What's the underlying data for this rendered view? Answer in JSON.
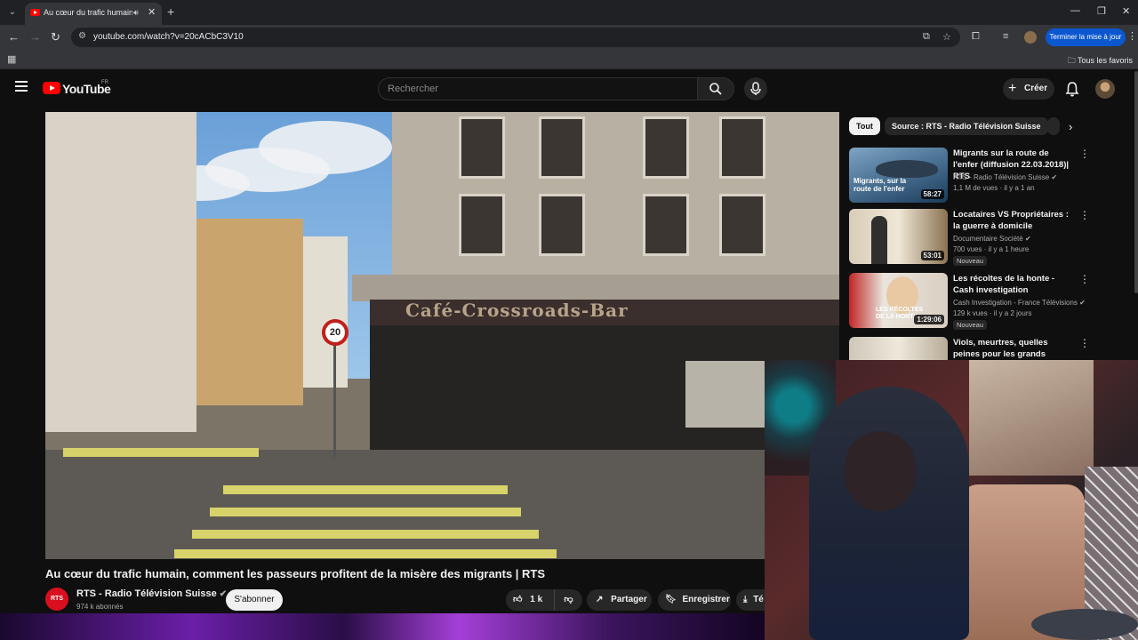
{
  "browser": {
    "tab_title": "Au cœur du trafic humain, c",
    "new_tab": "+",
    "url": "youtube.com/watch?v=20cACbC3V10",
    "update_button": "Terminer la mise à jour",
    "bookmarks_folder": "Tous les favoris"
  },
  "header": {
    "logo_text": "YouTube",
    "region": "FR",
    "search_placeholder": "Rechercher",
    "create_label": "Créer"
  },
  "video": {
    "sign_text": "Café-Crossroads-Bar",
    "speed_limit": "20",
    "title": "Au cœur du trafic humain, comment les passeurs profitent de la misère des migrants | RTS",
    "channel": {
      "logo": "RTS",
      "name": "RTS - Radio Télévision Suisse",
      "subscribers": "974 k abonnés"
    },
    "subscribe_label": "S'abonner",
    "likes": "1 k",
    "share_label": "Partager",
    "save_label": "Enregistrer",
    "download_label": "Té"
  },
  "chips": [
    "Tout",
    "Source : RTS - Radio Télévision Suisse"
  ],
  "recommendations": [
    {
      "title": "Migrants sur la route de l'enfer (diffusion 22.03.2018)| RTS",
      "channel": "RTS - Radio Télévision Suisse",
      "meta": "1,1 M de vues · il y a 1 an",
      "duration": "58:27",
      "thumb_text": "Migrants, sur la route de l'enfer",
      "badge": ""
    },
    {
      "title": "Locataires VS Propriétaires : la guerre à domicile",
      "channel": "Documentaire Société",
      "meta": "700 vues · il y a 1 heure",
      "duration": "53:01",
      "thumb_text": "",
      "badge": "Nouveau"
    },
    {
      "title": "Les récoltes de la honte - Cash investigation",
      "channel": "Cash Investigation - France Télévisions",
      "meta": "129 k vues · il y a 2 jours",
      "duration": "1:29:06",
      "thumb_text": "LES RÉCOLTES DE LA HONTE",
      "badge": "Nouveau"
    },
    {
      "title": "Viols, meurtres, quelles peines pour les grands assassins? | ...",
      "channel": "",
      "meta": "",
      "duration": "",
      "thumb_text": "",
      "badge": ""
    }
  ]
}
